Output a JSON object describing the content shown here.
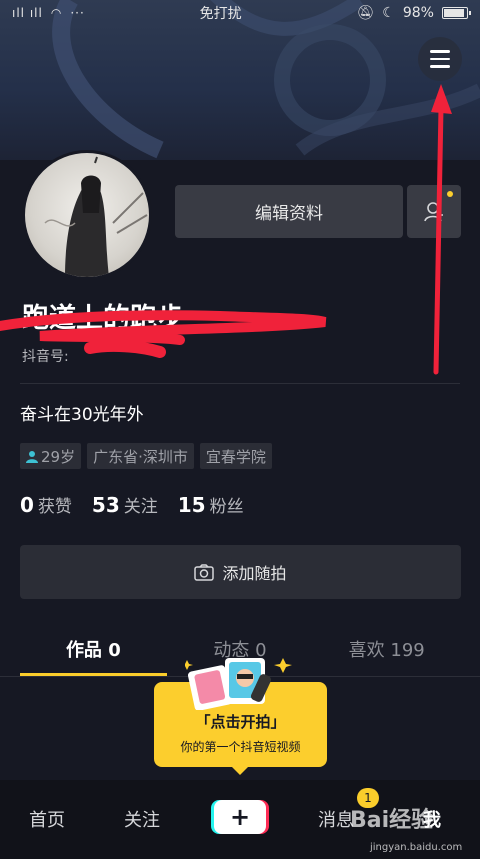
{
  "status_bar": {
    "signal_text": "ıll ıll",
    "center_text": "免打扰",
    "battery_text": "98%"
  },
  "profile": {
    "edit_label": "编辑资料",
    "username": "跑道上的跑步",
    "douyin_id_prefix": "抖音号:",
    "bio": "奋斗在30光年外",
    "tags": [
      "29岁",
      "广东省·深圳市",
      "宜春学院"
    ],
    "stats": [
      {
        "num": "0",
        "label": "获赞"
      },
      {
        "num": "53",
        "label": "关注"
      },
      {
        "num": "15",
        "label": "粉丝"
      }
    ],
    "add_story_label": "添加随拍"
  },
  "tabs": [
    {
      "label": "作品 0",
      "active": true
    },
    {
      "label": "动态 0",
      "active": false
    },
    {
      "label": "喜欢 199",
      "active": false
    }
  ],
  "tooltip": {
    "title": "「点击开拍」",
    "subtitle": "你的第一个抖音短视频"
  },
  "bottom_nav": {
    "home": "首页",
    "follow": "关注",
    "plus": "+",
    "messages": "消息",
    "messages_badge": "1",
    "me": "我"
  },
  "watermark": {
    "brand": "Bai经验",
    "url": "jingyan.baidu.com"
  },
  "colors": {
    "accent": "#facd2b",
    "background": "#161823",
    "annotation_red": "#f0223a"
  },
  "icons": [
    "menu-icon",
    "add-friend-icon",
    "camera-icon",
    "person-icon",
    "plus-icon"
  ]
}
